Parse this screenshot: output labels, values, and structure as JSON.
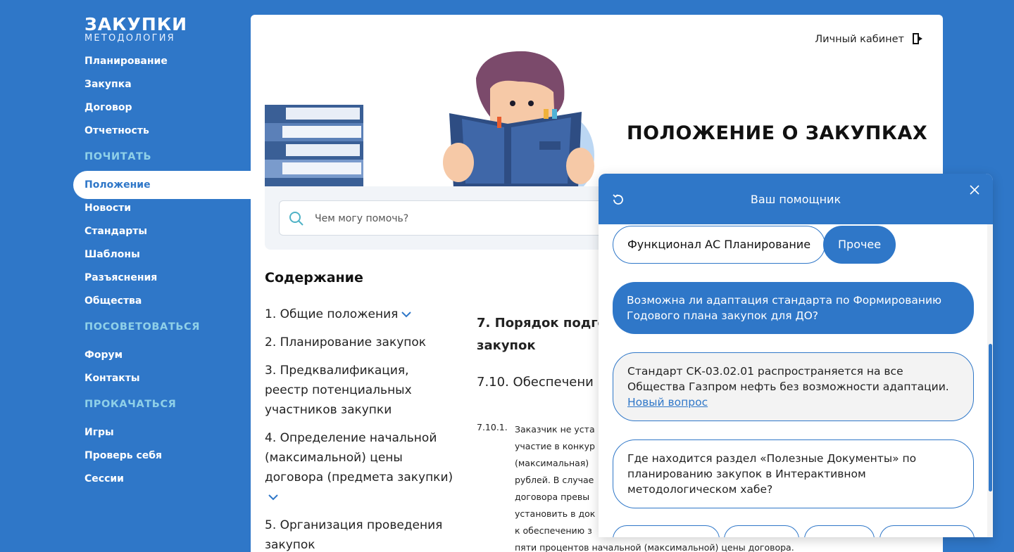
{
  "logo": {
    "main": "ЗАКУПКИ",
    "sub": "МЕТОДОЛОГИЯ"
  },
  "sidebar": {
    "items_top": [
      "Планирование",
      "Закупка",
      "Договор",
      "Отчетность"
    ],
    "section_read": "ПОЧИТАТЬ",
    "active_item": "Положение",
    "items_read": [
      "Новости",
      "Стандарты",
      "Шаблоны",
      "Разъяснения",
      "Общества"
    ],
    "section_advise": "ПОСОВЕТОВАТЬСЯ",
    "items_advise": [
      "Форум",
      "Контакты"
    ],
    "section_pump": "ПРОКАЧАТЬСЯ",
    "items_pump": [
      "Игры",
      "Проверь себя",
      "Сессии"
    ]
  },
  "header": {
    "cabinet_label": "Личный кабинет"
  },
  "hero": {
    "title": "ПОЛОЖЕНИЕ О ЗАКУПКАХ"
  },
  "search": {
    "placeholder": "Чем могу помочь?"
  },
  "toc": {
    "title": "Содержание",
    "items": [
      "1. Общие положения",
      "2. Планирование закупок",
      "3. Предквалификация, реестр потенциальных участников закупки",
      "4. Определение начальной (максимальной) цены договора (предмета закупки)",
      "5. Организация проведения закупок"
    ]
  },
  "document": {
    "heading": "7. Порядок подго закупок",
    "subheading": "7.10. Обеспечени",
    "clause_number": "7.10.1.",
    "clause_lines": [
      "Заказчик не уста",
      "участие в конкур",
      "(максимальная)",
      "рублей. В случае",
      "договора превы",
      "установить в док",
      "к обеспечению з",
      "пяти процентов начальной (максимальной) цены договора."
    ]
  },
  "chat": {
    "title": "Ваш помощник",
    "chips": [
      "Функционал АС Планирование",
      "Прочее"
    ],
    "user_question": "Возможна ли адаптация стандарта по Формированию Годового плана закупок для ДО?",
    "bot_answer": "Стандарт СК-03.02.01 распространяется на все Общества Газпром нефть без возможности адаптации.",
    "bot_link": "Новый вопрос",
    "suggested_question": "Где находится раздел «Полезные Документы» по планированию закупок в Интерактивном методологическом хабе?"
  }
}
